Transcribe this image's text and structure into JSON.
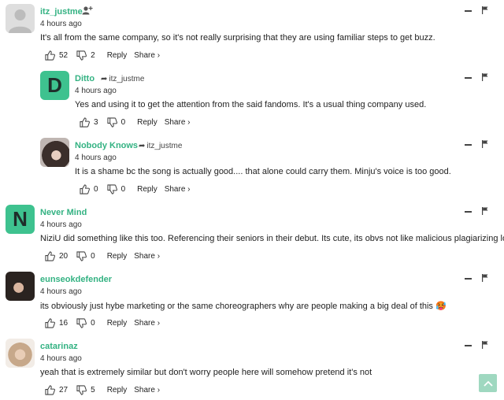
{
  "comments": [
    {
      "author": "itz_justme",
      "time": "4 hours ago",
      "text": "It's all from the same company, so it's not really surprising that they are using familiar steps to get buzz.",
      "likes": "52",
      "dislikes": "2",
      "reply_label": "Reply",
      "share_label": "Share ›",
      "avatar": "default-user-icon",
      "reply_to": ""
    },
    {
      "author": "Ditto",
      "time": "4 hours ago",
      "text": "Yes and using it to get the attention from the said fandoms. It's a usual thing company used.",
      "likes": "3",
      "dislikes": "0",
      "reply_label": "Reply",
      "share_label": "Share ›",
      "avatar_letter": "D",
      "reply_to": "itz_justme"
    },
    {
      "author": "Nobody Knows",
      "time": "4 hours ago",
      "text": "It is a shame bc the song is actually good.... that alone could carry them. Minju's voice is too good.",
      "likes": "0",
      "dislikes": "0",
      "reply_label": "Reply",
      "share_label": "Share ›",
      "reply_to": "itz_justme"
    },
    {
      "author": "Never Mind",
      "time": "4 hours ago",
      "text": "NiziU did something like this too. Referencing their seniors in their debut. Its cute, its obvs not like malicious plagiarizing lol",
      "likes": "20",
      "dislikes": "0",
      "reply_label": "Reply",
      "share_label": "Share ›",
      "avatar_letter": "N",
      "reply_to": ""
    },
    {
      "author": "eunseokdefender",
      "time": "4 hours ago",
      "text": "its obviously just hybe marketing or the same choreographers why are people making a big deal of this",
      "emoji": "🥵",
      "likes": "16",
      "dislikes": "0",
      "reply_label": "Reply",
      "share_label": "Share ›",
      "reply_to": ""
    },
    {
      "author": "catarinaz",
      "time": "4 hours ago",
      "text": "yeah that is extremely similar but don't worry people here will somehow pretend it's not",
      "likes": "27",
      "dislikes": "5",
      "reply_label": "Reply",
      "share_label": "Share ›",
      "reply_to": ""
    }
  ],
  "colors": {
    "accent": "#33b282",
    "avatar_letter_bg": "#3ec28f",
    "scroll_top_bg": "#9fd8c0"
  },
  "icons": {
    "like": "thumbs-up-icon",
    "dislike": "thumbs-down-icon",
    "collapse": "minus-icon",
    "flag": "flag-icon",
    "reply_to": "reply-arrow-icon",
    "follow": "add-user-icon",
    "scroll_top": "chevron-up-icon"
  }
}
